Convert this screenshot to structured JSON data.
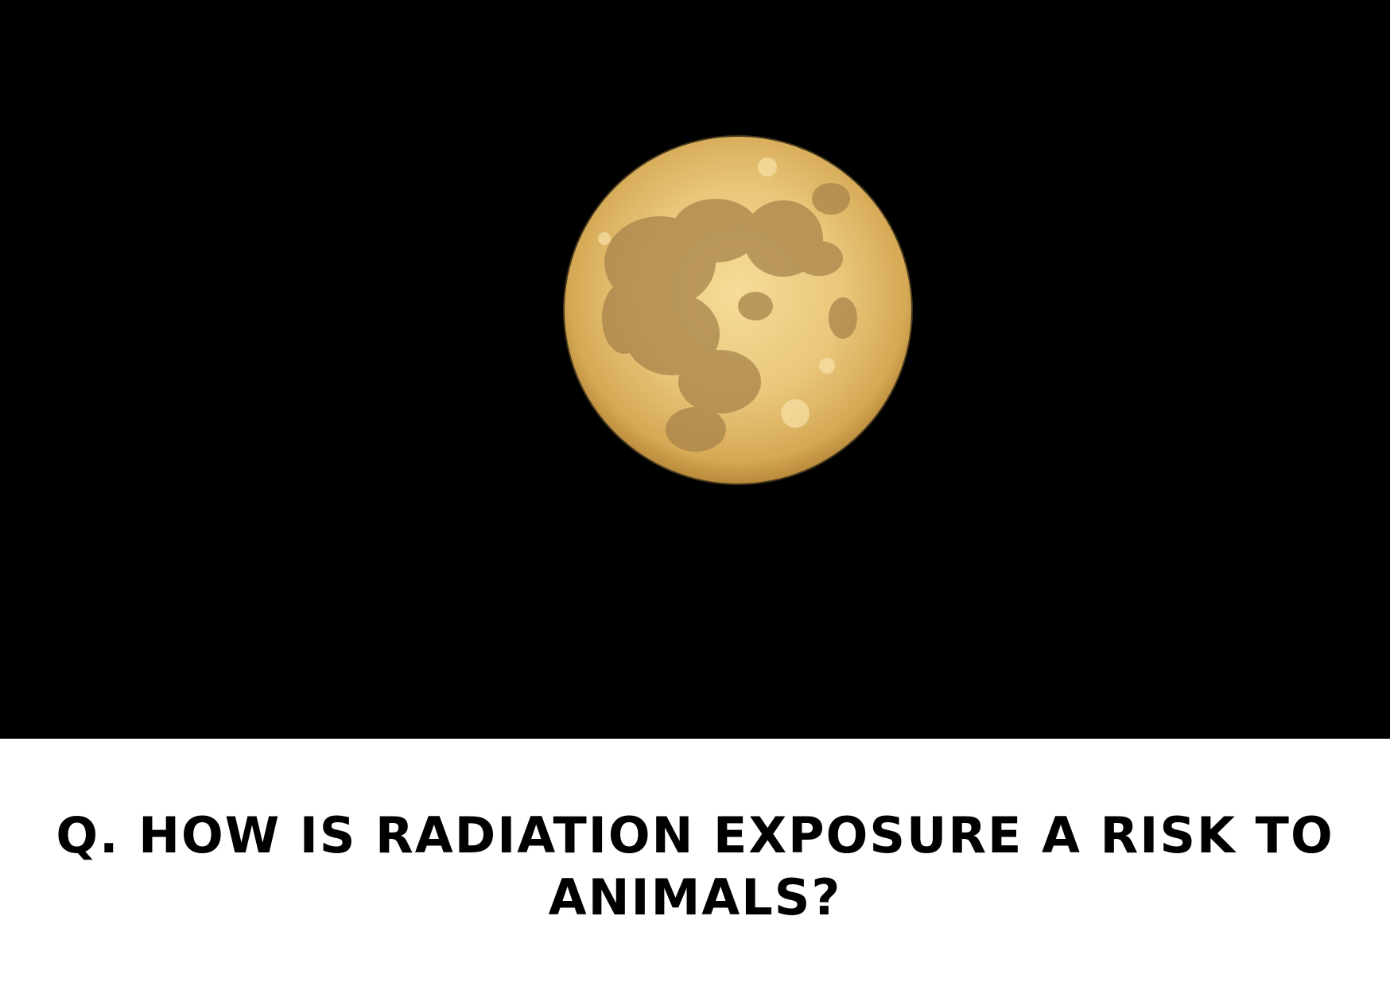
{
  "image": {
    "subject": "moon-icon",
    "background_color": "#000000",
    "moon_color": "#e8c16c"
  },
  "caption": {
    "text": "Q. HOW IS RADIATION EXPOSURE A RISK TO ANIMALS?"
  }
}
